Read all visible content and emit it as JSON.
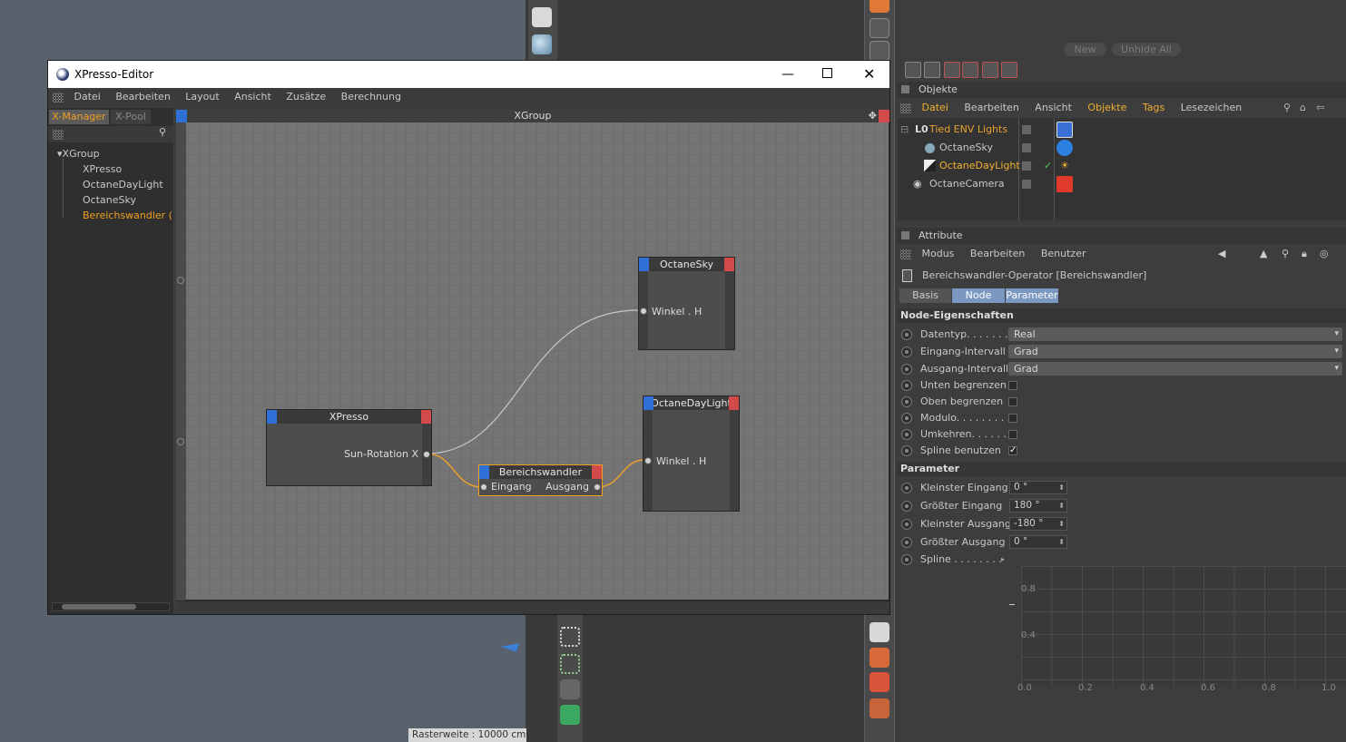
{
  "bg": {
    "status_text": "Rasterweite : 10000 cm"
  },
  "top_buttons": {
    "new": "New",
    "unhide_all": "Unhide All"
  },
  "objects": {
    "panel_title": "Objekte",
    "menu": [
      "Datei",
      "Bearbeiten",
      "Ansicht",
      "Objekte",
      "Tags",
      "Lesezeichen"
    ],
    "rows": [
      {
        "name": "Tied ENV Lights",
        "icon": "null-object-icon",
        "tag_color": "#3a6fd8"
      },
      {
        "name": "OctaneSky",
        "icon": "sky-icon",
        "tag_color": "#2d7fe0"
      },
      {
        "name": "OctaneDayLight",
        "icon": "daylight-icon",
        "tag_color": "#d8a020"
      },
      {
        "name": "OctaneCamera",
        "icon": "camera-icon",
        "tag_color": "#e03b2a"
      }
    ]
  },
  "attributes": {
    "panel_title": "Attribute",
    "menu": [
      "Modus",
      "Bearbeiten",
      "Benutzer"
    ],
    "operator_title": "Bereichswandler-Operator [Bereichswandler]",
    "tabs": [
      "Basis",
      "Node",
      "Parameter"
    ],
    "section_node": "Node-Eigenschaften",
    "datentyp_label": "Datentyp. . . . . . . . .",
    "datentyp_value": "Real",
    "eingang_label": "Eingang-Intervall",
    "eingang_value": "Grad",
    "ausgang_label": "Ausgang-Intervall",
    "ausgang_value": "Grad",
    "unten_label": "Unten begrenzen",
    "oben_label": "Oben begrenzen",
    "modulo_label": "Modulo. . . . . . . . .",
    "umkehren_label": "Umkehren. . . . . . .",
    "spline_benutzen_label": "Spline benutzen",
    "spline_benutzen_check": "✓",
    "section_param": "Parameter",
    "kl_eingang_label": "Kleinster Eingang",
    "kl_eingang_value": "0 °",
    "gr_eingang_label": "Größter Eingang",
    "gr_eingang_value": "180 °",
    "kl_ausgang_label": "Kleinster Ausgang",
    "kl_ausgang_value": "-180 °",
    "gr_ausgang_label": "Größter Ausgang",
    "gr_ausgang_value": "0 °",
    "spline_label": "Spline . . . . . . . .",
    "spline_y_labels": [
      "0.8",
      "0.4"
    ],
    "spline_x_labels": [
      "0.0",
      "0.2",
      "0.4",
      "0.6",
      "0.8",
      "1.0"
    ]
  },
  "xpresso": {
    "window_title": "XPresso-Editor",
    "menu": [
      "Datei",
      "Bearbeiten",
      "Layout",
      "Ansicht",
      "Zusätze",
      "Berechnung"
    ],
    "tab_manager": "X-Manager",
    "tab_pool": "X-Pool",
    "tree_root": "XGroup",
    "tree_items": [
      "XPresso",
      "OctaneDayLight",
      "OctaneSky",
      "Bereichswandler (R"
    ],
    "canvas_title": "XGroup",
    "nodes": {
      "sky_title": "OctaneSky",
      "sky_port": "Winkel . H",
      "daylight_title": "OctaneDayLight",
      "daylight_port": "Winkel . H",
      "xpresso_title": "XPresso",
      "xpresso_port": "Sun-Rotation X",
      "range_title": "Bereichswandler",
      "range_in": "Eingang",
      "range_out": "Ausgang"
    },
    "colors": {
      "wire_gray": "#c8c8c8",
      "wire_orange": "#e8a030",
      "accent_orange": "#f0a020"
    }
  }
}
